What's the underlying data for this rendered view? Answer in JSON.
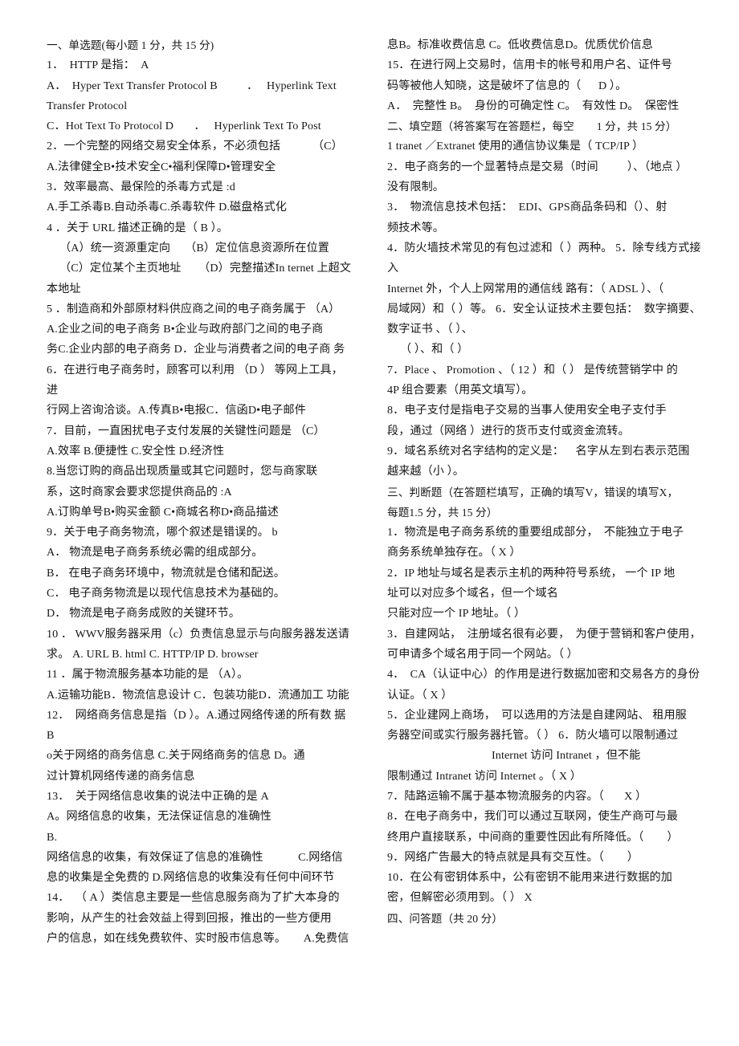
{
  "document": {
    "type": "exam-paper",
    "subject_hint": "电子商务",
    "columns": 2
  },
  "left_column": {
    "lines": [
      {
        "id": "l1",
        "text": "一、单选题(每小题 1 分，共 15 分)",
        "indent": "none",
        "role": "section-heading"
      },
      {
        "id": "l2",
        "text": "1．  HTTP 是指：  A",
        "indent": "none",
        "role": "question"
      },
      {
        "id": "l3",
        "text": "A．  Hyper Text Transfer Protocol B          ．   Hyperlink Text",
        "indent": "none",
        "role": "option"
      },
      {
        "id": "l4",
        "text": "Transfer Protocol",
        "indent": "none",
        "role": "option-cont"
      },
      {
        "id": "l5",
        "text": "C．Hot Text To Protocol D       ．   Hyperlink Text To Post",
        "indent": "none",
        "role": "option"
      },
      {
        "id": "l6",
        "text": "2．一个完整的网络交易安全体系，不必须包括           （C）",
        "indent": "none",
        "role": "question"
      },
      {
        "id": "l7",
        "text": "A.法律健全B•技术安全C•福利保障D•管理安全",
        "indent": "none",
        "role": "option"
      },
      {
        "id": "l8",
        "text": "3．效率最高、最保险的杀毒方式是 :d",
        "indent": "none",
        "role": "question"
      },
      {
        "id": "l9",
        "text": "A.手工杀毒B.自动杀毒C.杀毒软件 D.磁盘格式化",
        "indent": "none",
        "role": "option"
      },
      {
        "id": "l10",
        "text": "4 ．关于 URL 描述正确的是（ B ）。",
        "indent": "none",
        "role": "question"
      },
      {
        "id": "l11",
        "text": "（A）统一资源重定向     （B）定位信息资源所在位置",
        "indent": "small",
        "role": "option"
      },
      {
        "id": "l12",
        "text": "（C）定位某个主页地址      （D）完整描述In ternet 上超文",
        "indent": "small",
        "role": "option"
      },
      {
        "id": "l13",
        "text": "本地址",
        "indent": "none",
        "role": "option-cont"
      },
      {
        "id": "l14",
        "text": "5 ．制造商和外部原材料供应商之间的电子商务属于 （A）",
        "indent": "none",
        "role": "question"
      },
      {
        "id": "l15",
        "text": "A.企业之间的电子商务 B•企业与政府部门之间的电子商",
        "indent": "none",
        "role": "option"
      },
      {
        "id": "l16",
        "text": "务C.企业内部的电子商务 D．企业与消费者之间的电子商 务",
        "indent": "none",
        "role": "option-cont"
      },
      {
        "id": "l17",
        "text": "6．在进行电子商务时，顾客可以利用 （D ） 等网上工具，进",
        "indent": "none",
        "role": "question"
      },
      {
        "id": "l18",
        "text": "行网上咨询洽谈。A.传真B•电报C．信函D•电子邮件",
        "indent": "none",
        "role": "option"
      },
      {
        "id": "l19",
        "text": "7．目前，一直困扰电子支付发展的关键性问题是 （C）",
        "indent": "none",
        "role": "question"
      },
      {
        "id": "l20",
        "text": "A.效率 B.便捷性 C.安全性 D.经济性",
        "indent": "none",
        "role": "option"
      },
      {
        "id": "l21",
        "text": "8.当您订购的商品出现质量或其它问题时，您与商家联",
        "indent": "none",
        "role": "question"
      },
      {
        "id": "l22",
        "text": "系，这时商家会要求您提供商品的 :A",
        "indent": "none",
        "role": "question-cont"
      },
      {
        "id": "l23",
        "text": "A.订购单号B•购买金额 C•商城名称D•商品描述",
        "indent": "none",
        "role": "option"
      },
      {
        "id": "l24",
        "text": "9．关于电子商务物流，哪个叙述是错误的。 b",
        "indent": "none",
        "role": "question"
      },
      {
        "id": "l25",
        "text": "A． 物流是电子商务系统必需的组成部分。",
        "indent": "none",
        "role": "option"
      },
      {
        "id": "l26",
        "text": "B． 在电子商务环境中，物流就是仓储和配送。",
        "indent": "none",
        "role": "option"
      },
      {
        "id": "l27",
        "text": "C． 电子商务物流是以现代信息技术为基础的。",
        "indent": "none",
        "role": "option"
      },
      {
        "id": "l28",
        "text": "D． 物流是电子商务成败的关键环节。",
        "indent": "none",
        "role": "option"
      },
      {
        "id": "l29",
        "text": "10 ． WWV服务器采用（c）负责信息显示与向服务器发送请",
        "indent": "none",
        "role": "question"
      },
      {
        "id": "l30",
        "text": "求。 A. URL B. html C. HTTP/IP D. browser",
        "indent": "none",
        "role": "option"
      },
      {
        "id": "l31",
        "text": "11 ．属于物流服务基本功能的是 （A）。",
        "indent": "none",
        "role": "question"
      },
      {
        "id": "l32",
        "text": "A.运输功能B．物流信息设计 C．包装功能D．流通加工 功能",
        "indent": "none",
        "role": "option"
      },
      {
        "id": "l33",
        "text": "12．  网络商务信息是指（D ）。A.通过网络传递的所有数 据B",
        "indent": "none",
        "role": "question"
      },
      {
        "id": "l34",
        "text": "o关于网络的商务信息 C.关于网络商务的信息 D。通",
        "indent": "none",
        "role": "option"
      },
      {
        "id": "l35",
        "text": "过计算机网络传递的商务信息",
        "indent": "none",
        "role": "option-cont"
      },
      {
        "id": "l36",
        "text": "13．  关于网络信息收集的说法中正确的是 A",
        "indent": "none",
        "role": "question"
      },
      {
        "id": "l37",
        "text": "A。网络信息的收集，无法保证信息的准确性",
        "indent": "none",
        "role": "option"
      },
      {
        "id": "l38",
        "text": "B.",
        "indent": "none",
        "role": "option"
      },
      {
        "id": "l39",
        "text": "网络信息的收集，有效保证了信息的准确性            C.网络信",
        "indent": "none",
        "role": "option-cont"
      },
      {
        "id": "l40",
        "text": "息的收集是全免费的 D.网络信息的收集没有任何中间环节",
        "indent": "none",
        "role": "option-cont"
      },
      {
        "id": "l41",
        "text": "14．  （ A ）类信息主要是一些信息服务商为了扩大本身的",
        "indent": "none",
        "role": "question"
      },
      {
        "id": "l42",
        "text": "影响，从产生的社会效益上得到回报，推出的一些方便用",
        "indent": "none",
        "role": "question-cont"
      },
      {
        "id": "l43",
        "text": "户的信息，如在线免费软件、实时股市信息等。      A.免费信",
        "indent": "none",
        "role": "option"
      }
    ]
  },
  "right_column": {
    "lines": [
      {
        "id": "r1",
        "text": "息B。标准收费信息 C。低收费信息D。优质优价信息",
        "indent": "none",
        "role": "option-cont"
      },
      {
        "id": "r2",
        "text": "15．在进行网上交易时，信用卡的帐号和用户名、证件号",
        "indent": "none",
        "role": "question"
      },
      {
        "id": "r3",
        "text": "码等被他人知晓，这是破坏了信息的（      D ）。",
        "indent": "none",
        "role": "question-cont"
      },
      {
        "id": "r4",
        "text": "A．  完整性 B。  身份的可确定性 C。  有效性 D。  保密性",
        "indent": "none",
        "role": "option"
      },
      {
        "id": "r5",
        "text": "二、填空题（将答案写在答题栏，每空        1 分，共 15 分）",
        "indent": "none",
        "role": "section-heading"
      },
      {
        "id": "r6",
        "text": "1 tranet ／Extranet 使用的通信协议集是（ TCP/IP ）",
        "indent": "none",
        "role": "question"
      },
      {
        "id": "r7",
        "text": "2．电子商务的一个显著特点是交易（时间          ）、（地点 ）",
        "indent": "none",
        "role": "question"
      },
      {
        "id": "r8",
        "text": "没有限制。",
        "indent": "none",
        "role": "question-cont"
      },
      {
        "id": "r9",
        "text": "3．  物流信息技术包括：  EDI、GPS商品条码和（）、射",
        "indent": "none",
        "role": "question"
      },
      {
        "id": "r10",
        "text": "频技术等。",
        "indent": "none",
        "role": "question-cont"
      },
      {
        "id": "r11",
        "text": "4．防火墙技术常见的有包过滤和（ ）两种。 5．除专线方式接入",
        "indent": "none",
        "role": "question"
      },
      {
        "id": "r12",
        "text": "Internet 外，个人上网常用的通信线 路有：（ ADSL ）、（",
        "indent": "none",
        "role": "question-cont"
      },
      {
        "id": "r13",
        "text": "局域网）和（ ）等。 6．安全认证技术主要包括：  数字摘要、",
        "indent": "none",
        "role": "question-cont"
      },
      {
        "id": "r14",
        "text": "数字证书 、（ ）、",
        "indent": "none",
        "role": "question-cont"
      },
      {
        "id": "r15",
        "text": "（ ）、和（ ）",
        "indent": "small",
        "role": "question-cont"
      },
      {
        "id": "r16",
        "text": "7．Place 、 Promotion 、（ 12 ）和（ ） 是传统营销学中 的",
        "indent": "none",
        "role": "question"
      },
      {
        "id": "r17",
        "text": "4P 组合要素（用英文填写）。",
        "indent": "none",
        "role": "question-cont"
      },
      {
        "id": "r18",
        "text": "8．电子支付是指电子交易的当事人使用安全电子支付手",
        "indent": "none",
        "role": "question"
      },
      {
        "id": "r19",
        "text": "段，通过（网络 ）进行的货币支付或资金流转。",
        "indent": "none",
        "role": "question-cont"
      },
      {
        "id": "r20",
        "text": "9．域名系统对名字结构的定义是：    名字从左到右表示范围",
        "indent": "none",
        "role": "question"
      },
      {
        "id": "r21",
        "text": "越来越（小 ）。",
        "indent": "none",
        "role": "question-cont"
      },
      {
        "id": "r22",
        "text": "三、判断题（在答题栏填写，正确的填写V，错误的填写X，",
        "indent": "none",
        "role": "section-heading"
      },
      {
        "id": "r23",
        "text": "每题1.5 分，共 15 分）",
        "indent": "none",
        "role": "section-heading-cont"
      },
      {
        "id": "r24",
        "text": "1．物流是电子商务系统的重要组成部分，  不能独立于电子",
        "indent": "none",
        "role": "question"
      },
      {
        "id": "r25",
        "text": "商务系统单独存在。（ X ）",
        "indent": "none",
        "role": "question-cont"
      },
      {
        "id": "r26",
        "text": "2．IP 地址与域名是表示主机的两种符号系统， 一个 IP 地",
        "indent": "none",
        "role": "question"
      },
      {
        "id": "r27",
        "text": "址可以对应多个域名，但一个域名",
        "indent": "none",
        "role": "question-cont"
      },
      {
        "id": "r28",
        "text": "只能对应一个 IP 地址。（ ）",
        "indent": "none",
        "role": "question-cont"
      },
      {
        "id": "r29",
        "text": "3．自建网站，  注册域名很有必要，  为便于营销和客户使用，",
        "indent": "none",
        "role": "question"
      },
      {
        "id": "r30",
        "text": "可申请多个域名用于同一个网站。（ ）",
        "indent": "none",
        "role": "question-cont"
      },
      {
        "id": "r31",
        "text": "4．  CA（认证中心）的作用是进行数据加密和交易各方的身份",
        "indent": "none",
        "role": "question"
      },
      {
        "id": "r32",
        "text": "认证。（ X ）",
        "indent": "none",
        "role": "question-cont"
      },
      {
        "id": "r33",
        "text": "5．企业建网上商场，  可以选用的方法是自建网站、 租用服",
        "indent": "none",
        "role": "question"
      },
      {
        "id": "r34",
        "text": "务器空间或实行服务器托管。（ ） 6．防火墙可以限制通过",
        "indent": "none",
        "role": "question-cont"
      },
      {
        "id": "r35",
        "text": "Internet 访问 Intranet ，但不能",
        "indent": "large",
        "role": "question-cont"
      },
      {
        "id": "r36",
        "text": "限制通过 Intranet 访问 Internet 。（ X ）",
        "indent": "none",
        "role": "question-cont"
      },
      {
        "id": "r37",
        "text": "7．陆路运输不属于基本物流服务的内容。（       X ）",
        "indent": "none",
        "role": "question"
      },
      {
        "id": "r38",
        "text": "8．在电子商务中，我们可以通过互联网，使生产商可与最",
        "indent": "none",
        "role": "question"
      },
      {
        "id": "r39",
        "text": "终用户直接联系，中间商的重要性因此有所降低。（        ）",
        "indent": "none",
        "role": "question-cont"
      },
      {
        "id": "r40",
        "text": "9．网络广告最大的特点就是具有交互性。（        ）",
        "indent": "none",
        "role": "question"
      },
      {
        "id": "r41",
        "text": "10．在公有密钥体系中，公有密钥不能用来进行数据的加",
        "indent": "none",
        "role": "question"
      },
      {
        "id": "r42",
        "text": "密，但解密必须用到。（ ） X",
        "indent": "none",
        "role": "question-cont"
      },
      {
        "id": "r43",
        "text": "四、问答题（共 20 分）",
        "indent": "none",
        "role": "section-heading"
      }
    ]
  }
}
